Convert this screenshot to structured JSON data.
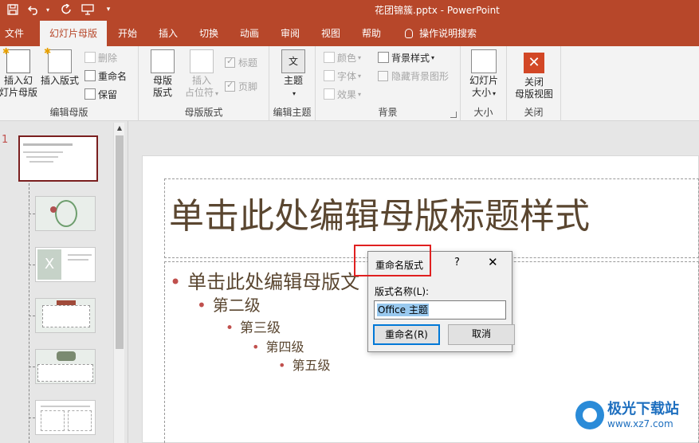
{
  "titlebar": {
    "doc_title": "花团锦簇.pptx  -  PowerPoint",
    "bg_color": "#b7472a",
    "qat_icons": [
      "save-icon",
      "undo-icon",
      "redo-icon",
      "present-from-start-icon",
      "customize-qat-icon"
    ]
  },
  "tabs": {
    "file": "文件",
    "slide_master": "幻灯片母版",
    "home": "开始",
    "insert": "插入",
    "transitions": "切换",
    "animations": "动画",
    "review": "审阅",
    "view": "视图",
    "help": "帮助",
    "tell_me": "操作说明搜索"
  },
  "ribbon": {
    "edit_master": {
      "label": "编辑母版",
      "insert_slide_master": "插入幻\n灯片母版",
      "insert_layout": "插入版式",
      "delete": "删除",
      "rename": "重命名",
      "preserve": "保留"
    },
    "master_layout": {
      "label": "母版版式",
      "master_layout_btn": "母版\n版式",
      "insert_placeholder": "插入\n占位符",
      "title_check": "标题",
      "footer_check": "页脚"
    },
    "edit_theme": {
      "label": "编辑主题",
      "themes": "主题"
    },
    "background": {
      "label": "背景",
      "colors": "颜色",
      "fonts": "字体",
      "effects": "效果",
      "background_styles": "背景样式",
      "hide_bg_graphics": "隐藏背景图形"
    },
    "size": {
      "label": "大小",
      "slide_size": "幻灯片\n大小"
    },
    "close": {
      "label": "关闭",
      "close_master_view": "关闭\n母版视图"
    }
  },
  "thumbnails": {
    "master_number": "1",
    "layout_count": 5
  },
  "slide": {
    "title": "单击此处编辑母版标题样式",
    "levels": [
      "单击此处编辑母版文",
      "第二级",
      "第三级",
      "第四级",
      "第五级"
    ]
  },
  "dialog": {
    "title": "重命名版式",
    "help": "?",
    "close": "✕",
    "field_label": "版式名称(L):",
    "field_value": "Office 主题",
    "ok": "重命名(R)",
    "cancel": "取消"
  },
  "watermark": {
    "name": "极光下载站",
    "url": "www.xz7.com"
  }
}
